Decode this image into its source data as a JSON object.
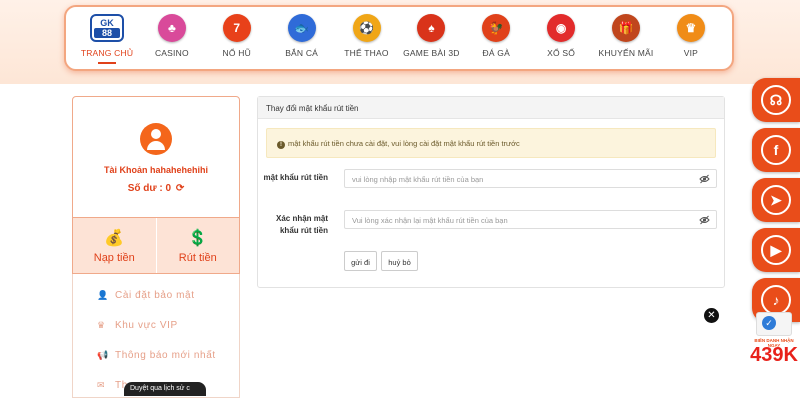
{
  "nav": {
    "items": [
      {
        "label": "TRANG CHỦ",
        "icon": "gk88-logo",
        "color": "#1d4fa8",
        "active": true
      },
      {
        "label": "CASINO",
        "icon": "casino-chip-icon",
        "color": "#d94a9a"
      },
      {
        "label": "NỔ HŨ",
        "icon": "slot-777-icon",
        "color": "#e8411a"
      },
      {
        "label": "BẮN CÁ",
        "icon": "fish-icon",
        "color": "#2f6bd8"
      },
      {
        "label": "THỂ THAO",
        "icon": "football-icon",
        "color": "#f0a617"
      },
      {
        "label": "GAME BÀI 3D",
        "icon": "cards-icon",
        "color": "#d9331a"
      },
      {
        "label": "ĐÁ GÀ",
        "icon": "rooster-icon",
        "color": "#e0411a"
      },
      {
        "label": "XỔ SỐ",
        "icon": "lottery-ball-icon",
        "color": "#e22b2b"
      },
      {
        "label": "KHUYẾN MÃI",
        "icon": "gift-icon",
        "color": "#c0461d"
      },
      {
        "label": "VIP",
        "icon": "vip-crown-icon",
        "color": "#f08c17"
      }
    ],
    "logo_top": "GK",
    "logo_bottom": "88"
  },
  "profile": {
    "account": "Tài Khoản hahahehehihi",
    "balance": "Số dư : 0"
  },
  "actions": {
    "deposit": "Nạp tiền",
    "withdraw": "Rút tiền"
  },
  "menu": [
    {
      "label": "Cài đặt bảo mật",
      "icon": "user-lock-icon"
    },
    {
      "label": "Khu vực VIP",
      "icon": "crown-icon"
    },
    {
      "label": "Thông báo mới nhất",
      "icon": "megaphone-icon"
    },
    {
      "label": "Th",
      "icon": "mail-icon"
    }
  ],
  "panel": {
    "title": "Thay đổi mật khẩu rút tiền",
    "alert": "mật khẩu rút tiền chưa cài đặt, vui lòng cài đặt mật khẩu rút tiền trước",
    "field1_label": "mật khẩu rút tiền",
    "field1_placeholder": "vui lòng nhập mật khẩu rút tiền của bạn",
    "field2_label": "Xác nhận mật khẩu rút tiền",
    "field2_placeholder": "Vui lòng xác nhận lại mật khẩu rút tiền của bạn",
    "submit": "gửi đi",
    "cancel": "huỷ bỏ"
  },
  "promo": {
    "caption": "BIẾN DANH NHẬN NGAY",
    "amount": "439K"
  },
  "tooltip": "Duyệt qua lịch sử c",
  "colors": {
    "accent": "#e0411a",
    "float": "#e94d1a"
  }
}
